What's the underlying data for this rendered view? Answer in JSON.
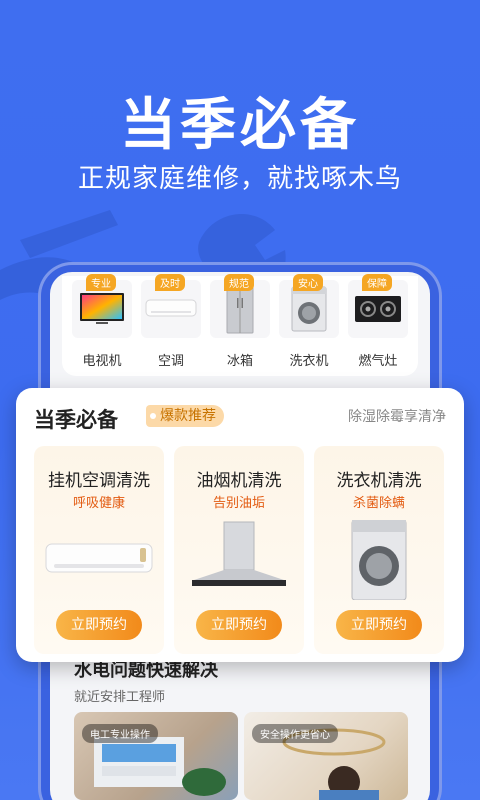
{
  "hero": {
    "title": "当季必备",
    "subtitle": "正规家庭维修，就找啄木鸟"
  },
  "categories": [
    {
      "tag": "专业",
      "label": "电视机",
      "icon": "tv-icon"
    },
    {
      "tag": "及时",
      "label": "空调",
      "icon": "air-conditioner-icon"
    },
    {
      "tag": "规范",
      "label": "冰箱",
      "icon": "fridge-icon"
    },
    {
      "tag": "安心",
      "label": "洗衣机",
      "icon": "washing-machine-icon"
    },
    {
      "tag": "保障",
      "label": "燃气灶",
      "icon": "gas-stove-icon"
    }
  ],
  "season_card": {
    "title": "当季必备",
    "badge": "爆款推荐",
    "right_text": "除湿除霉享清净",
    "services": [
      {
        "name": "挂机空调清洗",
        "desc": "呼吸健康",
        "button": "立即预约",
        "icon": "air-conditioner-icon"
      },
      {
        "name": "油烟机清洗",
        "desc": "告别油垢",
        "button": "立即预约",
        "icon": "range-hood-icon"
      },
      {
        "name": "洗衣机清洗",
        "desc": "杀菌除螨",
        "button": "立即预约",
        "icon": "washing-machine-icon"
      }
    ]
  },
  "section": {
    "title": "水电问题快速解决",
    "subtitle": "就近安排工程师",
    "photos": [
      {
        "tag": "电工专业操作"
      },
      {
        "tag": "安全操作更省心"
      }
    ]
  },
  "colors": {
    "background": "#3f6ef0",
    "accent_orange": "#f28a1a",
    "tag_orange": "#f5a623",
    "desc_red": "#e35b12"
  }
}
